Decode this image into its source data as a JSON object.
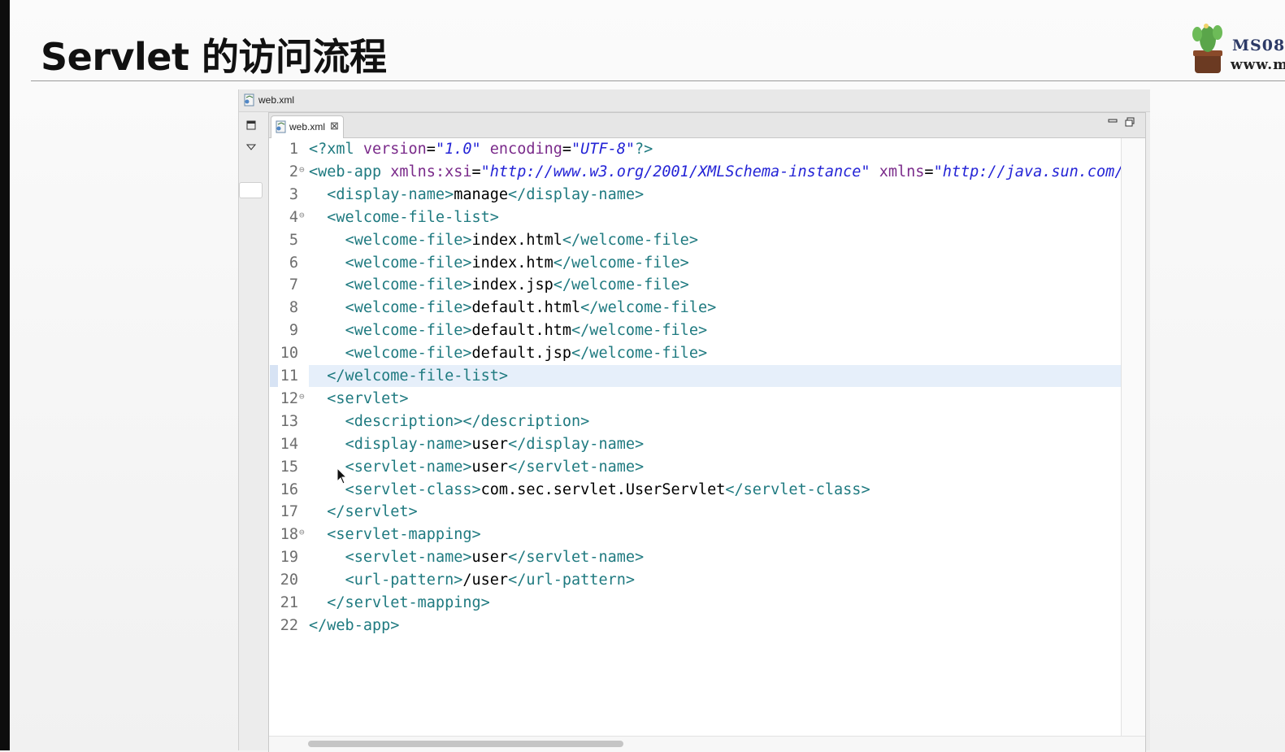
{
  "slide": {
    "title": "Servlet 的访问流程",
    "logo_text1": "MS08",
    "logo_text2": "www.m"
  },
  "window": {
    "title": "web.xml"
  },
  "editor": {
    "tab_label": "web.xml",
    "tab_close": "⊠",
    "current_line": 11,
    "lines": [
      {
        "n": "1",
        "fold": "",
        "html": "<span class='tg'>&lt;?xml </span><span class='an'>version</span>=<span class='av'>\"1.0\"</span> <span class='an'>encoding</span>=<span class='av'>\"UTF-8\"</span><span class='tg'>?&gt;</span>"
      },
      {
        "n": "2",
        "fold": "⊖",
        "html": "<span class='tg'>&lt;web-app </span><span class='an'>xmlns:xsi</span>=<span class='av'>\"http://www.w3.org/2001/XMLSchema-instance\"</span> <span class='an'>xmlns</span>=<span class='av'>\"http://java.sun.com/xml/ns/javaee\"</span>"
      },
      {
        "n": "3",
        "fold": "",
        "html": "  <span class='tg'>&lt;display-name&gt;</span>manage<span class='tg'>&lt;/display-name&gt;</span>"
      },
      {
        "n": "4",
        "fold": "⊖",
        "html": "  <span class='tg'>&lt;welcome-file-list&gt;</span>"
      },
      {
        "n": "5",
        "fold": "",
        "html": "    <span class='tg'>&lt;welcome-file&gt;</span>index.html<span class='tg'>&lt;/welcome-file&gt;</span>"
      },
      {
        "n": "6",
        "fold": "",
        "html": "    <span class='tg'>&lt;welcome-file&gt;</span>index.htm<span class='tg'>&lt;/welcome-file&gt;</span>"
      },
      {
        "n": "7",
        "fold": "",
        "html": "    <span class='tg'>&lt;welcome-file&gt;</span>index.jsp<span class='tg'>&lt;/welcome-file&gt;</span>"
      },
      {
        "n": "8",
        "fold": "",
        "html": "    <span class='tg'>&lt;welcome-file&gt;</span>default.html<span class='tg'>&lt;/welcome-file&gt;</span>"
      },
      {
        "n": "9",
        "fold": "",
        "html": "    <span class='tg'>&lt;welcome-file&gt;</span>default.htm<span class='tg'>&lt;/welcome-file&gt;</span>"
      },
      {
        "n": "10",
        "fold": "",
        "html": "    <span class='tg'>&lt;welcome-file&gt;</span>default.jsp<span class='tg'>&lt;/welcome-file&gt;</span>"
      },
      {
        "n": "11",
        "fold": "",
        "html": "  <span class='tg'>&lt;/welcome-file-list&gt;</span>"
      },
      {
        "n": "12",
        "fold": "⊖",
        "html": "  <span class='tg'>&lt;servlet&gt;</span>"
      },
      {
        "n": "13",
        "fold": "",
        "html": "    <span class='tg'>&lt;description&gt;&lt;/description&gt;</span>"
      },
      {
        "n": "14",
        "fold": "",
        "html": "    <span class='tg'>&lt;display-name&gt;</span>user<span class='tg'>&lt;/display-name&gt;</span>"
      },
      {
        "n": "15",
        "fold": "",
        "html": "    <span class='tg'>&lt;servlet-name&gt;</span>user<span class='tg'>&lt;/servlet-name&gt;</span>"
      },
      {
        "n": "16",
        "fold": "",
        "html": "    <span class='tg'>&lt;servlet-class&gt;</span>com.sec.servlet.UserServlet<span class='tg'>&lt;/servlet-class&gt;</span>"
      },
      {
        "n": "17",
        "fold": "",
        "html": "  <span class='tg'>&lt;/servlet&gt;</span>"
      },
      {
        "n": "18",
        "fold": "⊖",
        "html": "  <span class='tg'>&lt;servlet-mapping&gt;</span>"
      },
      {
        "n": "19",
        "fold": "",
        "html": "    <span class='tg'>&lt;servlet-name&gt;</span>user<span class='tg'>&lt;/servlet-name&gt;</span>"
      },
      {
        "n": "20",
        "fold": "",
        "html": "    <span class='tg'>&lt;url-pattern&gt;</span>/user<span class='tg'>&lt;/url-pattern&gt;</span>"
      },
      {
        "n": "21",
        "fold": "",
        "html": "  <span class='tg'>&lt;/servlet-mapping&gt;</span>"
      },
      {
        "n": "22",
        "fold": "",
        "html": "<span class='tg'>&lt;/web-app&gt;</span>"
      }
    ]
  },
  "colors": {
    "tag": "#1f7a80",
    "attr_name": "#7a2a8a",
    "attr_value": "#2323d6",
    "current_line": "#e6effa"
  }
}
